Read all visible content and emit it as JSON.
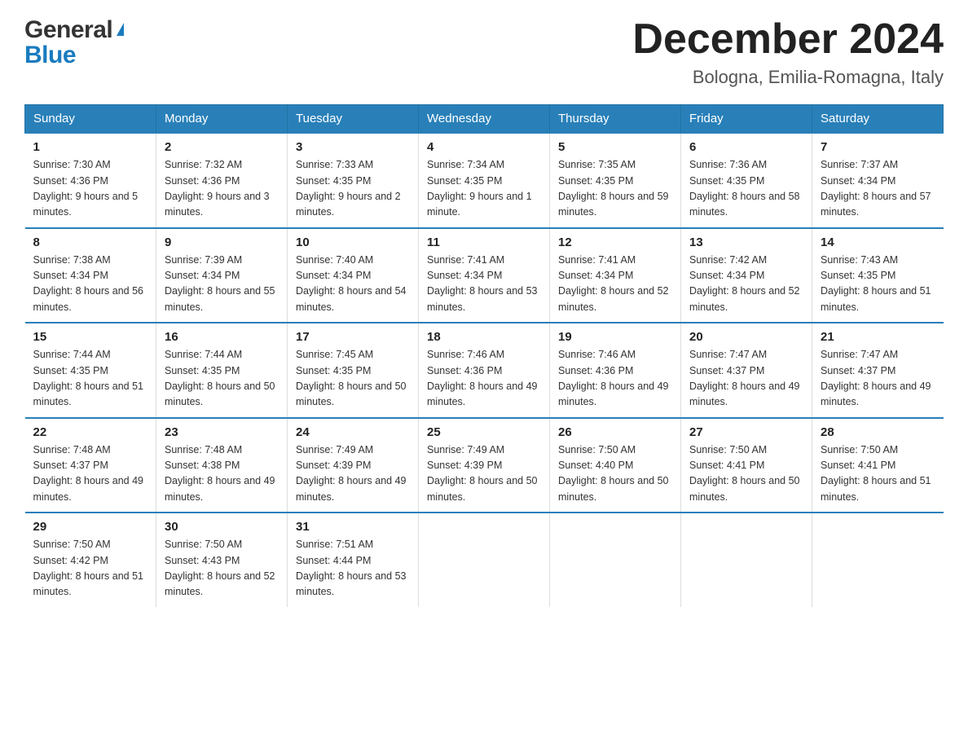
{
  "header": {
    "logo_general": "General",
    "logo_blue": "Blue",
    "month_title": "December 2024",
    "location": "Bologna, Emilia-Romagna, Italy"
  },
  "days_of_week": [
    "Sunday",
    "Monday",
    "Tuesday",
    "Wednesday",
    "Thursday",
    "Friday",
    "Saturday"
  ],
  "weeks": [
    [
      {
        "day": "1",
        "sunrise": "7:30 AM",
        "sunset": "4:36 PM",
        "daylight": "9 hours and 5 minutes."
      },
      {
        "day": "2",
        "sunrise": "7:32 AM",
        "sunset": "4:36 PM",
        "daylight": "9 hours and 3 minutes."
      },
      {
        "day": "3",
        "sunrise": "7:33 AM",
        "sunset": "4:35 PM",
        "daylight": "9 hours and 2 minutes."
      },
      {
        "day": "4",
        "sunrise": "7:34 AM",
        "sunset": "4:35 PM",
        "daylight": "9 hours and 1 minute."
      },
      {
        "day": "5",
        "sunrise": "7:35 AM",
        "sunset": "4:35 PM",
        "daylight": "8 hours and 59 minutes."
      },
      {
        "day": "6",
        "sunrise": "7:36 AM",
        "sunset": "4:35 PM",
        "daylight": "8 hours and 58 minutes."
      },
      {
        "day": "7",
        "sunrise": "7:37 AM",
        "sunset": "4:34 PM",
        "daylight": "8 hours and 57 minutes."
      }
    ],
    [
      {
        "day": "8",
        "sunrise": "7:38 AM",
        "sunset": "4:34 PM",
        "daylight": "8 hours and 56 minutes."
      },
      {
        "day": "9",
        "sunrise": "7:39 AM",
        "sunset": "4:34 PM",
        "daylight": "8 hours and 55 minutes."
      },
      {
        "day": "10",
        "sunrise": "7:40 AM",
        "sunset": "4:34 PM",
        "daylight": "8 hours and 54 minutes."
      },
      {
        "day": "11",
        "sunrise": "7:41 AM",
        "sunset": "4:34 PM",
        "daylight": "8 hours and 53 minutes."
      },
      {
        "day": "12",
        "sunrise": "7:41 AM",
        "sunset": "4:34 PM",
        "daylight": "8 hours and 52 minutes."
      },
      {
        "day": "13",
        "sunrise": "7:42 AM",
        "sunset": "4:34 PM",
        "daylight": "8 hours and 52 minutes."
      },
      {
        "day": "14",
        "sunrise": "7:43 AM",
        "sunset": "4:35 PM",
        "daylight": "8 hours and 51 minutes."
      }
    ],
    [
      {
        "day": "15",
        "sunrise": "7:44 AM",
        "sunset": "4:35 PM",
        "daylight": "8 hours and 51 minutes."
      },
      {
        "day": "16",
        "sunrise": "7:44 AM",
        "sunset": "4:35 PM",
        "daylight": "8 hours and 50 minutes."
      },
      {
        "day": "17",
        "sunrise": "7:45 AM",
        "sunset": "4:35 PM",
        "daylight": "8 hours and 50 minutes."
      },
      {
        "day": "18",
        "sunrise": "7:46 AM",
        "sunset": "4:36 PM",
        "daylight": "8 hours and 49 minutes."
      },
      {
        "day": "19",
        "sunrise": "7:46 AM",
        "sunset": "4:36 PM",
        "daylight": "8 hours and 49 minutes."
      },
      {
        "day": "20",
        "sunrise": "7:47 AM",
        "sunset": "4:37 PM",
        "daylight": "8 hours and 49 minutes."
      },
      {
        "day": "21",
        "sunrise": "7:47 AM",
        "sunset": "4:37 PM",
        "daylight": "8 hours and 49 minutes."
      }
    ],
    [
      {
        "day": "22",
        "sunrise": "7:48 AM",
        "sunset": "4:37 PM",
        "daylight": "8 hours and 49 minutes."
      },
      {
        "day": "23",
        "sunrise": "7:48 AM",
        "sunset": "4:38 PM",
        "daylight": "8 hours and 49 minutes."
      },
      {
        "day": "24",
        "sunrise": "7:49 AM",
        "sunset": "4:39 PM",
        "daylight": "8 hours and 49 minutes."
      },
      {
        "day": "25",
        "sunrise": "7:49 AM",
        "sunset": "4:39 PM",
        "daylight": "8 hours and 50 minutes."
      },
      {
        "day": "26",
        "sunrise": "7:50 AM",
        "sunset": "4:40 PM",
        "daylight": "8 hours and 50 minutes."
      },
      {
        "day": "27",
        "sunrise": "7:50 AM",
        "sunset": "4:41 PM",
        "daylight": "8 hours and 50 minutes."
      },
      {
        "day": "28",
        "sunrise": "7:50 AM",
        "sunset": "4:41 PM",
        "daylight": "8 hours and 51 minutes."
      }
    ],
    [
      {
        "day": "29",
        "sunrise": "7:50 AM",
        "sunset": "4:42 PM",
        "daylight": "8 hours and 51 minutes."
      },
      {
        "day": "30",
        "sunrise": "7:50 AM",
        "sunset": "4:43 PM",
        "daylight": "8 hours and 52 minutes."
      },
      {
        "day": "31",
        "sunrise": "7:51 AM",
        "sunset": "4:44 PM",
        "daylight": "8 hours and 53 minutes."
      },
      null,
      null,
      null,
      null
    ]
  ]
}
